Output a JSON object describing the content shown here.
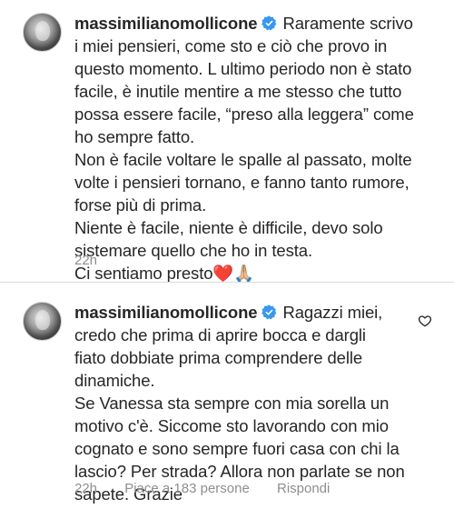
{
  "comments": [
    {
      "username": "massimilianomollicone",
      "first_line": "Raramente scrivo",
      "lines": [
        "i miei pensieri, come sto e ciò che provo in",
        "questo momento. L ultimo periodo non è stato",
        "facile, è inutile mentire a me stesso che tutto",
        "possa essere facile, “preso alla leggera” come",
        "ho sempre fatto.",
        "Non è facile voltare le spalle al passato, molte",
        "volte i pensieri tornano, e fanno tanto rumore,",
        "forse più di prima.",
        "Niente è facile, niente è difficile, devo solo",
        "sistemare quello che ho in testa.",
        "Ci sentiamo presto❤️🙏🏼"
      ],
      "time": "22h"
    },
    {
      "username": "massimilianomollicone",
      "first_line": "Ragazzi miei,",
      "lines": [
        "credo che prima di aprire bocca e dargli",
        "fiato dobbiate prima comprendere delle",
        "dinamiche.",
        "Se Vanessa sta sempre con mia sorella un",
        "motivo c'è. Siccome sto lavorando con mio",
        "cognato e sono sempre fuori casa con chi la",
        "lascio? Per strada? Allora non parlate se non",
        "sapete. Grazie"
      ],
      "time": "22h",
      "likes": "Piace a 183 persone",
      "reply": "Rispondi"
    }
  ],
  "icons": {
    "verified": "verified-badge-icon",
    "like": "heart-outline-icon"
  },
  "colors": {
    "verified_blue": "#3897f0",
    "meta_gray": "#8e8e8e"
  }
}
